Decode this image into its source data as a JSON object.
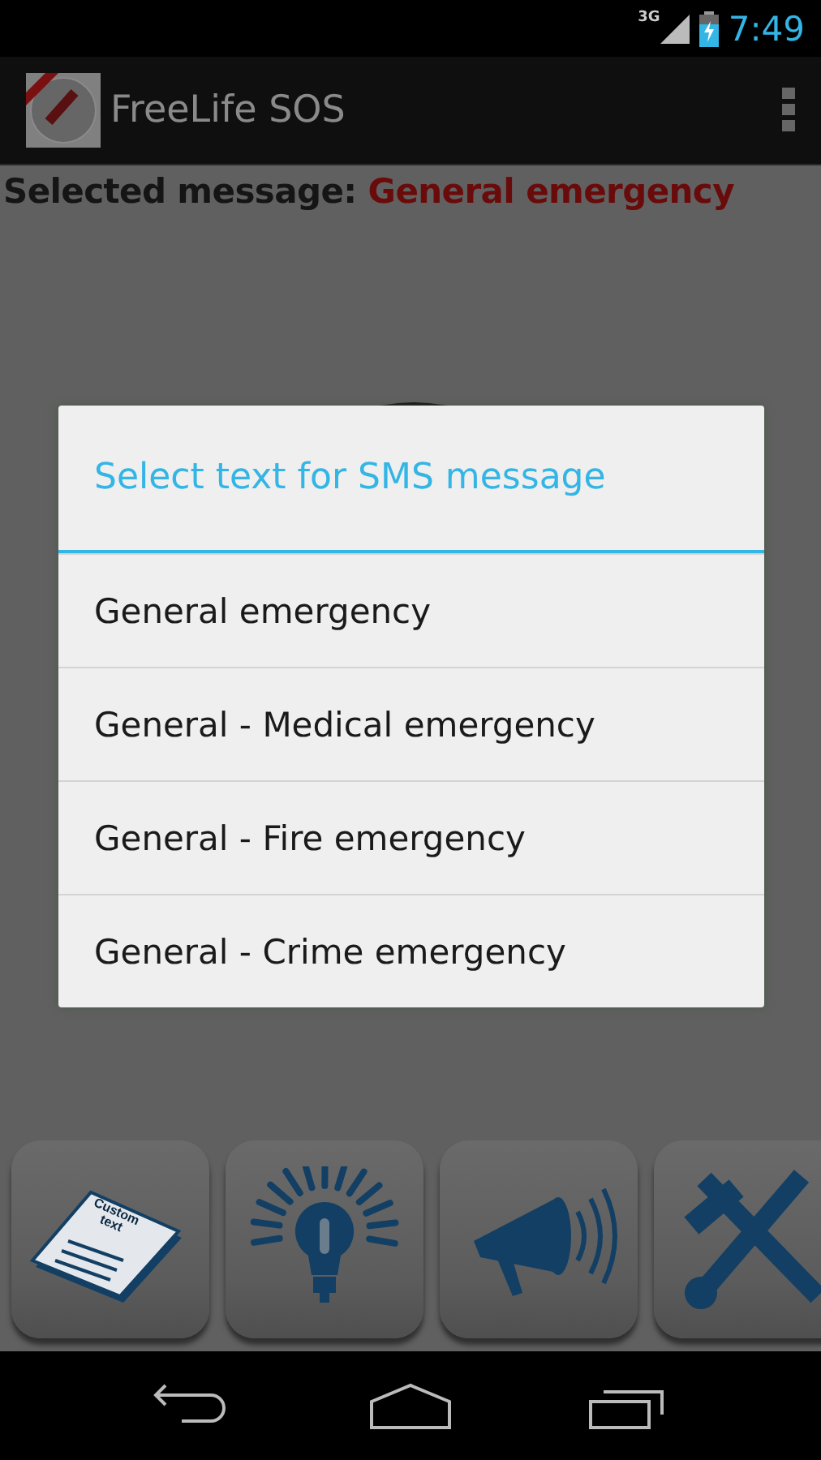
{
  "status_bar": {
    "network": "3G",
    "time": "7:49"
  },
  "app_bar": {
    "title": "FreeLife SOS"
  },
  "selected_message": {
    "label": "Selected message:",
    "value": "General emergency"
  },
  "dialog": {
    "title": "Select text for SMS message",
    "items": [
      {
        "label": "General emergency"
      },
      {
        "label": "General - Medical emergency"
      },
      {
        "label": "General - Fire emergency"
      },
      {
        "label": "General - Crime emergency"
      }
    ]
  },
  "tiles": [
    {
      "kind": "custom_text",
      "label": "Custom text"
    },
    {
      "kind": "idea"
    },
    {
      "kind": "megaphone"
    },
    {
      "kind": "tools"
    }
  ]
}
